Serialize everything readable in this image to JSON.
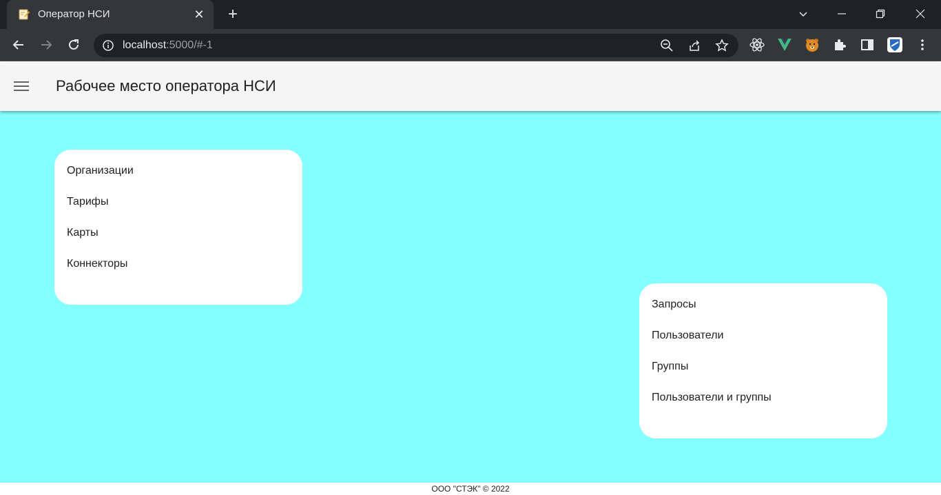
{
  "browser": {
    "tab_title": "Оператор НСИ",
    "url_host": "localhost",
    "url_rest": ":5000/#-1"
  },
  "header": {
    "title": "Рабочее место оператора НСИ"
  },
  "cards": {
    "left": [
      "Организации",
      "Тарифы",
      "Карты",
      "Коннекторы"
    ],
    "right": [
      "Запросы",
      "Пользователи",
      "Группы",
      "Пользователи и группы"
    ]
  },
  "footer": {
    "text": "ООО \"СТЭК\" © 2022"
  },
  "colors": {
    "main_background": "#84ffff",
    "header_background": "#f5f5f5",
    "card_background": "#ffffff"
  }
}
